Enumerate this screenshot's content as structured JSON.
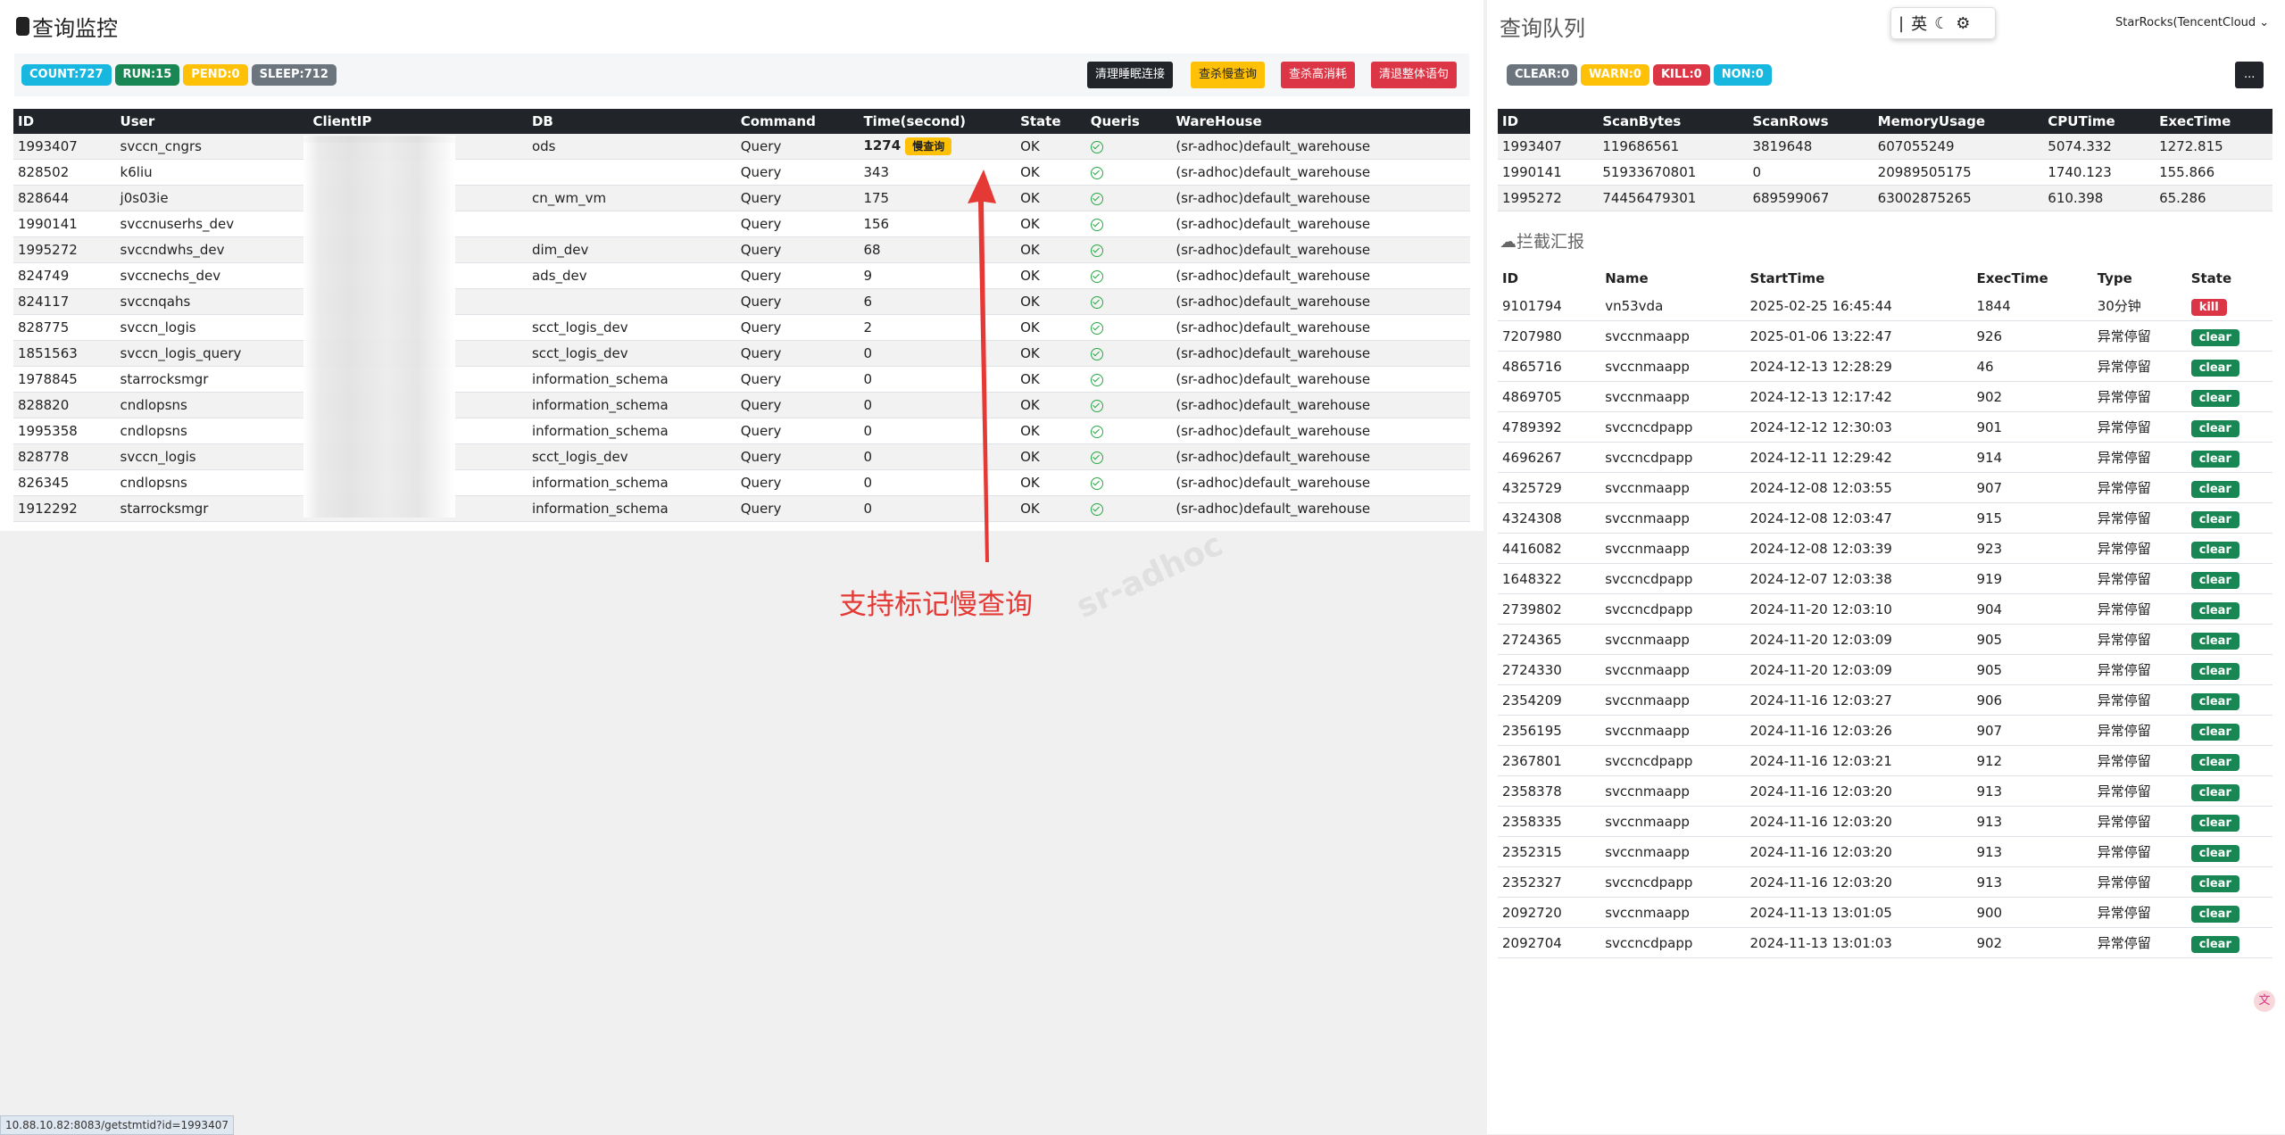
{
  "left": {
    "title": "查询监控",
    "badges": [
      {
        "label": "COUNT:727",
        "color": "#17b7e0"
      },
      {
        "label": "RUN:15",
        "color": "#198754"
      },
      {
        "label": "PEND:0",
        "color": "#ffc107"
      },
      {
        "label": "SLEEP:712",
        "color": "#6c757d"
      }
    ],
    "buttons": [
      "清理睡眠连接",
      "查杀慢查询",
      "查杀高消耗",
      "清退整体语句"
    ],
    "columns": [
      "ID",
      "User",
      "ClientIP",
      "DB",
      "Command",
      "Time(second)",
      "State",
      "Queris",
      "WareHouse"
    ],
    "slow_tag": "慢查询",
    "rows": [
      [
        "1993407",
        "svccn_cngrs",
        "",
        "ods",
        "Query",
        "1274",
        "OK",
        "",
        "(sr-adhoc)default_warehouse"
      ],
      [
        "828502",
        "k6liu",
        "",
        "",
        "Query",
        "343",
        "OK",
        "",
        "(sr-adhoc)default_warehouse"
      ],
      [
        "828644",
        "j0s03ie",
        "",
        "cn_wm_vm",
        "Query",
        "175",
        "OK",
        "",
        "(sr-adhoc)default_warehouse"
      ],
      [
        "1990141",
        "svccnuserhs_dev",
        "",
        "",
        "Query",
        "156",
        "OK",
        "",
        "(sr-adhoc)default_warehouse"
      ],
      [
        "1995272",
        "svccndwhs_dev",
        "",
        "dim_dev",
        "Query",
        "68",
        "OK",
        "",
        "(sr-adhoc)default_warehouse"
      ],
      [
        "824749",
        "svccnechs_dev",
        "",
        "ads_dev",
        "Query",
        "9",
        "OK",
        "",
        "(sr-adhoc)default_warehouse"
      ],
      [
        "824117",
        "svccnqahs",
        "",
        "",
        "Query",
        "6",
        "OK",
        "",
        "(sr-adhoc)default_warehouse"
      ],
      [
        "828775",
        "svccn_logis",
        "",
        "scct_logis_dev",
        "Query",
        "2",
        "OK",
        "",
        "(sr-adhoc)default_warehouse"
      ],
      [
        "1851563",
        "svccn_logis_query",
        "",
        "scct_logis_dev",
        "Query",
        "0",
        "OK",
        "",
        "(sr-adhoc)default_warehouse"
      ],
      [
        "1978845",
        "starrocksmgr",
        "",
        "information_schema",
        "Query",
        "0",
        "OK",
        "",
        "(sr-adhoc)default_warehouse"
      ],
      [
        "828820",
        "cndlopsns",
        "",
        "information_schema",
        "Query",
        "0",
        "OK",
        "",
        "(sr-adhoc)default_warehouse"
      ],
      [
        "1995358",
        "cndlopsns",
        "",
        "information_schema",
        "Query",
        "0",
        "OK",
        "",
        "(sr-adhoc)default_warehouse"
      ],
      [
        "828778",
        "svccn_logis",
        "",
        "scct_logis_dev",
        "Query",
        "0",
        "OK",
        "",
        "(sr-adhoc)default_warehouse"
      ],
      [
        "826345",
        "cndlopsns",
        "",
        "information_schema",
        "Query",
        "0",
        "OK",
        "",
        "(sr-adhoc)default_warehouse"
      ],
      [
        "1912292",
        "starrocksmgr",
        "",
        "information_schema",
        "Query",
        "0",
        "OK",
        "",
        "(sr-adhoc)default_warehouse"
      ]
    ]
  },
  "right": {
    "title": "查询队列",
    "cluster": "StarRocks(TencentCloud",
    "badges": [
      {
        "label": "CLEAR:0",
        "color": "#6c757d"
      },
      {
        "label": "WARN:0",
        "color": "#ffc107"
      },
      {
        "label": "KILL:0",
        "color": "#dc3545"
      },
      {
        "label": "NON:0",
        "color": "#17b7e0"
      }
    ],
    "more_label": "...",
    "queue_columns": [
      "ID",
      "ScanBytes",
      "ScanRows",
      "MemoryUsage",
      "CPUTime",
      "ExecTime"
    ],
    "queue_rows": [
      [
        "1993407",
        "119686561",
        "3819648",
        "607055249",
        "5074.332",
        "1272.815"
      ],
      [
        "1990141",
        "51933670801",
        "0",
        "20989505175",
        "1740.123",
        "155.866"
      ],
      [
        "1995272",
        "74456479301",
        "689599067",
        "63002875265",
        "610.398",
        "65.286"
      ]
    ],
    "intercept_title": "拦截汇报",
    "intercept_columns": [
      "ID",
      "Name",
      "StartTime",
      "ExecTime",
      "Type",
      "State"
    ],
    "intercept_rows": [
      [
        "9101794",
        "vn53vda",
        "2025-02-25 16:45:44",
        "1844",
        "30分钟",
        "kill"
      ],
      [
        "7207980",
        "svccnmaapp",
        "2025-01-06 13:22:47",
        "926",
        "异常停留",
        "clear"
      ],
      [
        "4865716",
        "svccnmaapp",
        "2024-12-13 12:28:29",
        "46",
        "异常停留",
        "clear"
      ],
      [
        "4869705",
        "svccnmaapp",
        "2024-12-13 12:17:42",
        "902",
        "异常停留",
        "clear"
      ],
      [
        "4789392",
        "svccncdpapp",
        "2024-12-12 12:30:03",
        "901",
        "异常停留",
        "clear"
      ],
      [
        "4696267",
        "svccncdpapp",
        "2024-12-11 12:29:42",
        "914",
        "异常停留",
        "clear"
      ],
      [
        "4325729",
        "svccnmaapp",
        "2024-12-08 12:03:55",
        "907",
        "异常停留",
        "clear"
      ],
      [
        "4324308",
        "svccnmaapp",
        "2024-12-08 12:03:47",
        "915",
        "异常停留",
        "clear"
      ],
      [
        "4416082",
        "svccnmaapp",
        "2024-12-08 12:03:39",
        "923",
        "异常停留",
        "clear"
      ],
      [
        "1648322",
        "svccncdpapp",
        "2024-12-07 12:03:38",
        "919",
        "异常停留",
        "clear"
      ],
      [
        "2739802",
        "svccncdpapp",
        "2024-11-20 12:03:10",
        "904",
        "异常停留",
        "clear"
      ],
      [
        "2724365",
        "svccnmaapp",
        "2024-11-20 12:03:09",
        "905",
        "异常停留",
        "clear"
      ],
      [
        "2724330",
        "svccnmaapp",
        "2024-11-20 12:03:09",
        "905",
        "异常停留",
        "clear"
      ],
      [
        "2354209",
        "svccnmaapp",
        "2024-11-16 12:03:27",
        "906",
        "异常停留",
        "clear"
      ],
      [
        "2356195",
        "svccnmaapp",
        "2024-11-16 12:03:26",
        "907",
        "异常停留",
        "clear"
      ],
      [
        "2367801",
        "svccncdpapp",
        "2024-11-16 12:03:21",
        "912",
        "异常停留",
        "clear"
      ],
      [
        "2358378",
        "svccnmaapp",
        "2024-11-16 12:03:20",
        "913",
        "异常停留",
        "clear"
      ],
      [
        "2358335",
        "svccnmaapp",
        "2024-11-16 12:03:20",
        "913",
        "异常停留",
        "clear"
      ],
      [
        "2352315",
        "svccnmaapp",
        "2024-11-16 12:03:20",
        "913",
        "异常停留",
        "clear"
      ],
      [
        "2352327",
        "svccncdpapp",
        "2024-11-16 12:03:20",
        "913",
        "异常停留",
        "clear"
      ],
      [
        "2092720",
        "svccnmaapp",
        "2024-11-13 13:01:05",
        "900",
        "异常停留",
        "clear"
      ],
      [
        "2092704",
        "svccncdpapp",
        "2024-11-13 13:01:03",
        "902",
        "异常停留",
        "clear"
      ]
    ]
  },
  "annotation": "支持标记慢查询",
  "watermark": "sr-adhoc",
  "ime_lang": "英",
  "status_url": "10.88.10.82:8083/getstmtid?id=1993407"
}
